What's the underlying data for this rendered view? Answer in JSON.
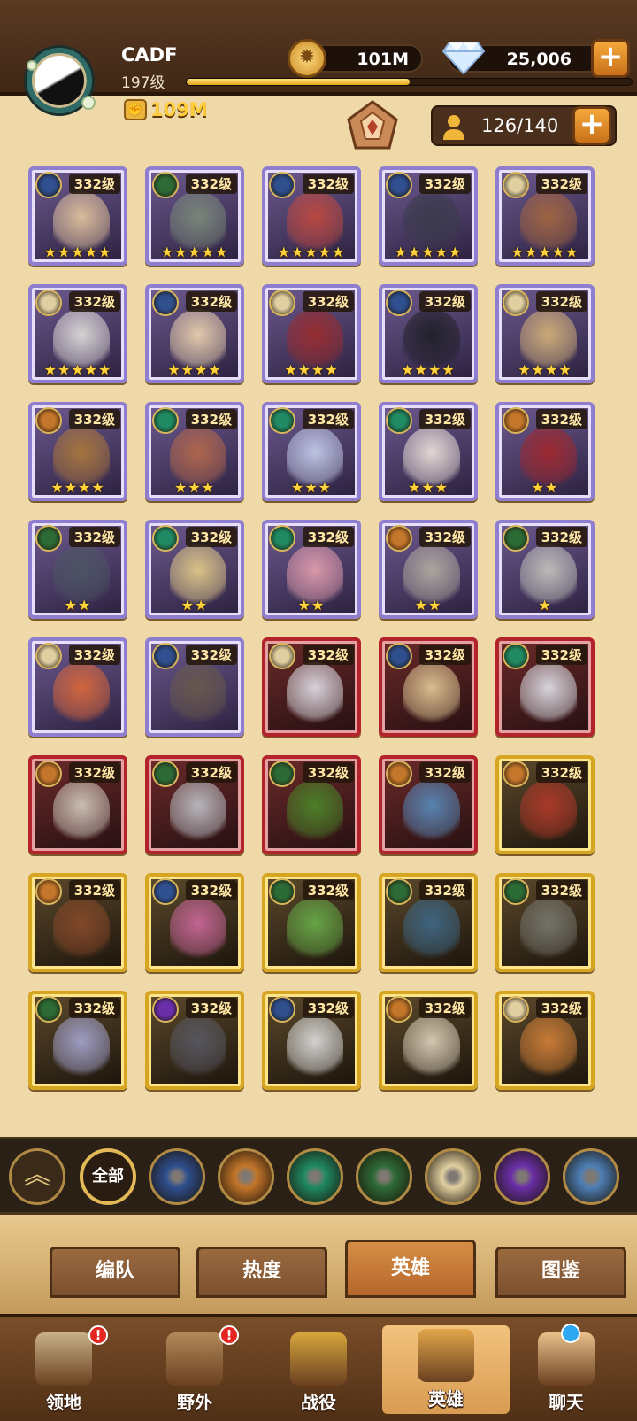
{
  "player": {
    "name": "CADF",
    "level": "197级",
    "power": "109M",
    "xp_progress": 0.5
  },
  "currency": {
    "gold": "101M",
    "gems": "25,006"
  },
  "roster": {
    "count": "126/140"
  },
  "faction_colors": {
    "celestial": "#2f4f8f",
    "graveborn": "#2d6b36",
    "wilder": "#1f8a63",
    "mauler": "#c4762a",
    "lightbearer": "#e0cfa0",
    "hypogean": "#6a2fa8"
  },
  "heroes": [
    {
      "level": "332级",
      "frame": "purple",
      "faction": "celestial",
      "stars": "★★★★★",
      "color": "#e9c9a0"
    },
    {
      "level": "332级",
      "frame": "purple",
      "faction": "graveborn",
      "stars": "★★★★★",
      "color": "#7d8c7a"
    },
    {
      "level": "332级",
      "frame": "purple",
      "faction": "celestial",
      "stars": "★★★★★",
      "color": "#c44a3e"
    },
    {
      "level": "332级",
      "frame": "purple",
      "faction": "celestial",
      "stars": "★★★★★",
      "color": "#3a3a4a"
    },
    {
      "level": "332级",
      "frame": "purple",
      "faction": "lightbearer",
      "stars": "★★★★★",
      "color": "#a8683e"
    },
    {
      "level": "332级",
      "frame": "purple",
      "faction": "lightbearer",
      "stars": "★★★★★",
      "color": "#e6e2de"
    },
    {
      "level": "332级",
      "frame": "purple",
      "faction": "celestial",
      "stars": "★★★★",
      "color": "#f1d7b2"
    },
    {
      "level": "332级",
      "frame": "purple",
      "faction": "lightbearer",
      "stars": "★★★★",
      "color": "#9d2b2b"
    },
    {
      "level": "332级",
      "frame": "purple",
      "faction": "celestial",
      "stars": "★★★★",
      "color": "#1e1e24"
    },
    {
      "level": "332级",
      "frame": "purple",
      "faction": "lightbearer",
      "stars": "★★★★",
      "color": "#d9b67a"
    },
    {
      "level": "332级",
      "frame": "purple",
      "faction": "mauler",
      "stars": "★★★★",
      "color": "#b07a3a"
    },
    {
      "level": "332级",
      "frame": "purple",
      "faction": "wilder",
      "stars": "★★★",
      "color": "#b96a4a"
    },
    {
      "level": "332级",
      "frame": "purple",
      "faction": "wilder",
      "stars": "★★★",
      "color": "#c9d2f0"
    },
    {
      "level": "332级",
      "frame": "purple",
      "faction": "wilder",
      "stars": "★★★",
      "color": "#f3e7de"
    },
    {
      "level": "332级",
      "frame": "purple",
      "faction": "mauler",
      "stars": "★★",
      "color": "#a4272b"
    },
    {
      "level": "332级",
      "frame": "purple",
      "faction": "graveborn",
      "stars": "★★",
      "color": "#4d5664"
    },
    {
      "level": "332级",
      "frame": "purple",
      "faction": "wilder",
      "stars": "★★",
      "color": "#e8d08a"
    },
    {
      "level": "332级",
      "frame": "purple",
      "faction": "wilder",
      "stars": "★★",
      "color": "#e9a2b1"
    },
    {
      "level": "332级",
      "frame": "purple",
      "faction": "mauler",
      "stars": "★★",
      "color": "#b8b0a4"
    },
    {
      "level": "332级",
      "frame": "purple",
      "faction": "graveborn",
      "stars": "★",
      "color": "#c8c8c0"
    },
    {
      "level": "332级",
      "frame": "purple",
      "faction": "lightbearer",
      "stars": "",
      "color": "#e06a3a"
    },
    {
      "level": "332级",
      "frame": "purple",
      "faction": "celestial",
      "stars": "",
      "color": "#6a5a4a"
    },
    {
      "level": "332级",
      "frame": "red",
      "faction": "lightbearer",
      "stars": "",
      "color": "#e6e6ee"
    },
    {
      "level": "332级",
      "frame": "red",
      "faction": "celestial",
      "stars": "",
      "color": "#e8cf9a"
    },
    {
      "level": "332级",
      "frame": "red",
      "faction": "wilder",
      "stars": "",
      "color": "#e5e8f0"
    },
    {
      "level": "332级",
      "frame": "red",
      "faction": "mauler",
      "stars": "",
      "color": "#d8cfc3"
    },
    {
      "level": "332级",
      "frame": "red",
      "faction": "graveborn",
      "stars": "",
      "color": "#c3c6cc"
    },
    {
      "level": "332级",
      "frame": "red",
      "faction": "graveborn",
      "stars": "",
      "color": "#4c8a2a"
    },
    {
      "level": "332级",
      "frame": "red",
      "faction": "mauler",
      "stars": "",
      "color": "#5a8ec0"
    },
    {
      "level": "332级",
      "frame": "gold",
      "faction": "mauler",
      "stars": "",
      "color": "#b53a2a"
    },
    {
      "level": "332级",
      "frame": "gold",
      "faction": "mauler",
      "stars": "",
      "color": "#8a4a2a"
    },
    {
      "level": "332级",
      "frame": "gold",
      "faction": "celestial",
      "stars": "",
      "color": "#d16ba0"
    },
    {
      "level": "332级",
      "frame": "gold",
      "faction": "graveborn",
      "stars": "",
      "color": "#6ab04a"
    },
    {
      "level": "332级",
      "frame": "gold",
      "faction": "graveborn",
      "stars": "",
      "color": "#3e6a8a"
    },
    {
      "level": "332级",
      "frame": "gold",
      "faction": "graveborn",
      "stars": "",
      "color": "#7a7a72"
    },
    {
      "level": "332级",
      "frame": "gold",
      "faction": "graveborn",
      "stars": "",
      "color": "#a9a9d6"
    },
    {
      "level": "332级",
      "frame": "gold",
      "faction": "hypogean",
      "stars": "",
      "color": "#5a5a66"
    },
    {
      "level": "332级",
      "frame": "gold",
      "faction": "celestial",
      "stars": "",
      "color": "#e4e4e4"
    },
    {
      "level": "332级",
      "frame": "gold",
      "faction": "mauler",
      "stars": "",
      "color": "#e2d7c0"
    },
    {
      "level": "332级",
      "frame": "gold",
      "faction": "lightbearer",
      "stars": "",
      "color": "#d8843a"
    }
  ],
  "filters": {
    "all_label": "全部",
    "factions": [
      {
        "name": "celestial",
        "color": "#2f4f8f"
      },
      {
        "name": "mauler",
        "color": "#c4762a"
      },
      {
        "name": "wilder",
        "color": "#1f8a63"
      },
      {
        "name": "graveborn",
        "color": "#2d6b36"
      },
      {
        "name": "lightbearer",
        "color": "#e0cfa0"
      },
      {
        "name": "hypogean",
        "color": "#6a2fa8"
      },
      {
        "name": "dimensional",
        "color": "#4d7fb5"
      }
    ]
  },
  "tabs": [
    {
      "label": "编队",
      "active": false
    },
    {
      "label": "热度",
      "active": false
    },
    {
      "label": "英雄",
      "active": true
    },
    {
      "label": "图鉴",
      "active": false
    }
  ],
  "nav": [
    {
      "label": "领地",
      "badge": "!",
      "icon": "castle-icon",
      "color": "#c9b18a"
    },
    {
      "label": "野外",
      "badge": "!",
      "icon": "scroll-map-icon",
      "color": "#b08a5a"
    },
    {
      "label": "战役",
      "badge": "",
      "icon": "sword-shield-icon",
      "color": "#d7a63c"
    },
    {
      "label": "英雄",
      "badge": "",
      "icon": "helmet-icon",
      "color": "#e2a64a",
      "active": true
    },
    {
      "label": "聊天",
      "badge": "dot",
      "icon": "chat-bubble-icon",
      "color": "#e8c08a"
    }
  ]
}
